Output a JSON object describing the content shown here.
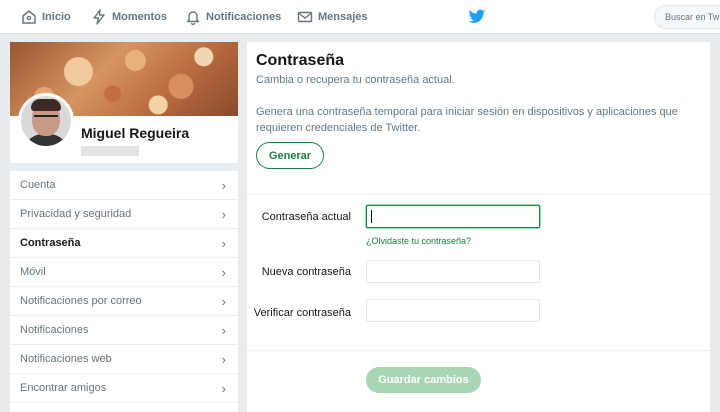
{
  "nav": {
    "home_label": "Inicio",
    "moments_label": "Momentos",
    "notifications_label": "Notificaciones",
    "messages_label": "Mensajes",
    "search_placeholder": "Buscar en Twitter"
  },
  "colors": {
    "brand": "#1da1f2",
    "accent": "#17853d"
  },
  "profile": {
    "name": "Miguel Regueira"
  },
  "menu": {
    "items": [
      {
        "label": "Cuenta",
        "active": false
      },
      {
        "label": "Privacidad y seguridad",
        "active": false
      },
      {
        "label": "Contraseña",
        "active": true
      },
      {
        "label": "Móvil",
        "active": false
      },
      {
        "label": "Notificaciones por correo",
        "active": false
      },
      {
        "label": "Notificaciones",
        "active": false
      },
      {
        "label": "Notificaciones web",
        "active": false
      },
      {
        "label": "Encontrar amigos",
        "active": false
      }
    ],
    "chevron": "›"
  },
  "main": {
    "title": "Contraseña",
    "subtitle": "Cambia o recupera tu contraseña actual.",
    "description": "Genera una contraseña temporal para iniciar sesión en dispositivos y aplicaciones que requieren credenciales de Twitter.",
    "generate_label": "Generar",
    "current_password_label": "Contraseña actual",
    "forgot_link": "¿Olvidaste tu contraseña?",
    "new_password_label": "Nueva contraseña",
    "verify_password_label": "Verificar contraseña",
    "save_label": "Guardar cambios"
  }
}
